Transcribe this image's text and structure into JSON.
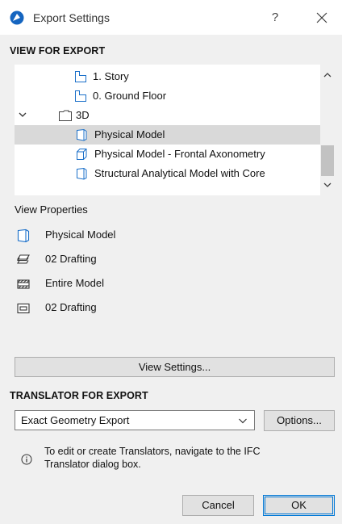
{
  "window": {
    "title": "Export Settings",
    "help_label": "?"
  },
  "view_section": {
    "title": "VIEW FOR EXPORT"
  },
  "tree": {
    "items": [
      {
        "label": "1. Story",
        "icon": "story-icon"
      },
      {
        "label": "0. Ground Floor",
        "icon": "story-icon"
      },
      {
        "label": "3D",
        "icon": "folder-icon",
        "expanded": true
      },
      {
        "label": "Physical Model",
        "icon": "3d-view-icon",
        "selected": true
      },
      {
        "label": "Physical Model - Frontal Axonometry",
        "icon": "axonometry-icon"
      },
      {
        "label": "Structural Analytical Model with Core",
        "icon": "3d-view-icon"
      }
    ]
  },
  "view_properties": {
    "title": "View Properties",
    "items": [
      {
        "label": "Physical Model",
        "icon": "model-view-icon"
      },
      {
        "label": "02 Drafting",
        "icon": "layer-combination-icon"
      },
      {
        "label": "Entire Model",
        "icon": "structure-display-icon"
      },
      {
        "label": "02 Drafting",
        "icon": "pen-set-icon"
      }
    ]
  },
  "buttons": {
    "view_settings": "View Settings...",
    "options": "Options...",
    "cancel": "Cancel",
    "ok": "OK"
  },
  "translator_section": {
    "title": "TRANSLATOR FOR EXPORT",
    "selected": "Exact Geometry Export",
    "info": "To edit or create Translators, navigate to the IFC Translator dialog box."
  },
  "colors": {
    "accent_blue": "#0078d7",
    "icon_blue": "#1a6fc9",
    "selected_row": "#d9d9d9",
    "dialog_bg": "#f0f0f0"
  }
}
